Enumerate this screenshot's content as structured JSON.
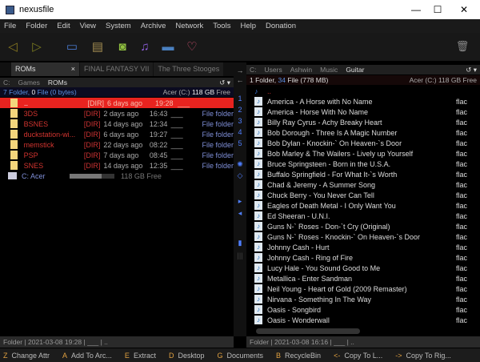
{
  "window": {
    "title": "nexusfile",
    "minimize": "—",
    "maximize": "☐",
    "close": "✕"
  },
  "menu": [
    "File",
    "Folder",
    "Edit",
    "View",
    "System",
    "Archive",
    "Network",
    "Tools",
    "Help",
    "Donation"
  ],
  "toolbar": {
    "back": "◁",
    "forward": "▷",
    "desktop": "▭",
    "documents": "▤",
    "pictures": "◙",
    "music": "♫",
    "videos": "▬",
    "favorites": "♡",
    "recycle": "🗑"
  },
  "left": {
    "tabs": [
      {
        "label": "ROMs",
        "close": "×"
      },
      {
        "label": "FINAL FANTASY VII"
      },
      {
        "label": "The Three Stooges"
      }
    ],
    "path": [
      "C:",
      "Games",
      "ROMs"
    ],
    "refresh": "↺ ▾",
    "info": {
      "folders": "7",
      "folder_label": "Folder,",
      "files": "0",
      "file_label": "File (0 bytes)",
      "free": "Acer (C:)",
      "free_size": "118 GB",
      "free_label": "Free"
    },
    "rows": [
      {
        "name": "..",
        "dir": "[DIR]",
        "date": "6 days ago",
        "time": "19:28",
        "blank": "___",
        "type": ""
      },
      {
        "name": "3DS",
        "dir": "[DIR]",
        "date": "2 days ago",
        "time": "16:43",
        "blank": "___",
        "type": "File folder"
      },
      {
        "name": "BSNES",
        "dir": "[DIR]",
        "date": "14 days ago",
        "time": "12:34",
        "blank": "___",
        "type": "File folder"
      },
      {
        "name": "duckstation-wi...",
        "dir": "[DIR]",
        "date": "6 days ago",
        "time": "19:27",
        "blank": "___",
        "type": "File folder"
      },
      {
        "name": "memstick",
        "dir": "[DIR]",
        "date": "22 days ago",
        "time": "08:22",
        "blank": "___",
        "type": "File folder"
      },
      {
        "name": "PSP",
        "dir": "[DIR]",
        "date": "7 days ago",
        "time": "08:45",
        "blank": "___",
        "type": "File folder"
      },
      {
        "name": "SNES",
        "dir": "[DIR]",
        "date": "14 days ago",
        "time": "12:35",
        "blank": "___",
        "type": "File folder"
      }
    ],
    "drive": {
      "label": "C: Acer",
      "free": "118 GB Free",
      "used_fraction": 0.72
    },
    "status": "Folder | 2021-03-08 19:28 | ___ | .."
  },
  "middle": [
    "1",
    "2",
    "3",
    "4",
    "5"
  ],
  "right": {
    "path": [
      "C:",
      "Users",
      "Ashwin",
      "Music",
      "Guitar"
    ],
    "refresh": "↺ ▾",
    "info": {
      "folders": "1",
      "folder_label": "Folder,",
      "files": "34",
      "file_label": "File (778 MB)",
      "free": "Acer (C:) 118 GB Free"
    },
    "parent": "..",
    "files": [
      "America - A Horse with No Name",
      "America - Horse With No Name",
      "Billy Ray Cyrus - Achy Breaky Heart",
      "Bob Dorough - Three Is A Magic Number",
      "Bob Dylan - Knockin-` On Heaven-`s Door",
      "Bob Marley & The Wailers - Lively up Yourself",
      "Bruce Springsteen - Born in the U.S.A.",
      "Buffalo Springfield - For What It-`s Worth",
      "Chad & Jeremy - A Summer Song",
      "Chuck Berry - You Never Can Tell",
      "Eagles of Death Metal - I Only Want You",
      "Ed Sheeran - U.N.I.",
      "Guns N-` Roses - Don-`t Cry (Original)",
      "Guns N-` Roses - Knockin-` On Heaven-`s Door",
      "Johnny Cash - Hurt",
      "Johnny Cash - Ring of Fire",
      "Lucy Hale - You Sound Good to Me",
      "Metallica - Enter Sandman",
      "Neil Young - Heart of Gold (2009 Remaster)",
      "Nirvana - Something In The Way",
      "Oasis - Songbird",
      "Oasis - Wonderwall"
    ],
    "ext": "flac",
    "status": "Folder | 2021-03-08 16:16 | ___ | .."
  },
  "fkeys": [
    {
      "k": "Z",
      "l": "Change Attr"
    },
    {
      "k": "A",
      "l": "Add To Arc..."
    },
    {
      "k": "E",
      "l": "Extract"
    },
    {
      "k": "D",
      "l": "Desktop"
    },
    {
      "k": "G",
      "l": "Documents"
    },
    {
      "k": "B",
      "l": "RecycleBin"
    },
    {
      "k": "<-",
      "l": "Copy To L..."
    },
    {
      "k": "->",
      "l": "Copy To Rig..."
    }
  ]
}
